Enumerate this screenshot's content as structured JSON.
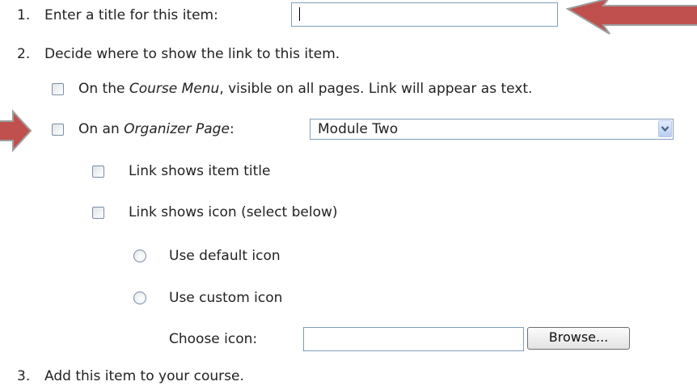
{
  "steps": {
    "s1_num": "1.",
    "s1_label": "Enter a title for this item:",
    "s2_num": "2.",
    "s2_label": "Decide where to show the link to this item.",
    "s3_num": "3.",
    "s3_label": "Add this item to your course."
  },
  "course_menu": {
    "pre": "On the ",
    "em": "Course Menu",
    "post": ", visible on all pages. Link will appear as text."
  },
  "organizer": {
    "pre": "On an ",
    "em": "Organizer Page",
    "post": ":",
    "selected": "Module Two"
  },
  "options": {
    "link_title": "Link shows item title",
    "link_icon": "Link shows icon (select below)",
    "default_icon": "Use default icon",
    "custom_icon": "Use custom icon",
    "choose_icon": "Choose icon:",
    "browse": "Browse..."
  },
  "title_input": {
    "value": ""
  },
  "choose_icon_input": {
    "value": ""
  },
  "colors": {
    "arrow_fill": "#c0504d",
    "arrow_border": "#9e9e9e",
    "control_border": "#7f9db9"
  },
  "icons": {
    "dropdown": "chevron-down-icon",
    "annotation": "left-arrow-icon, right-arrow-icon"
  }
}
